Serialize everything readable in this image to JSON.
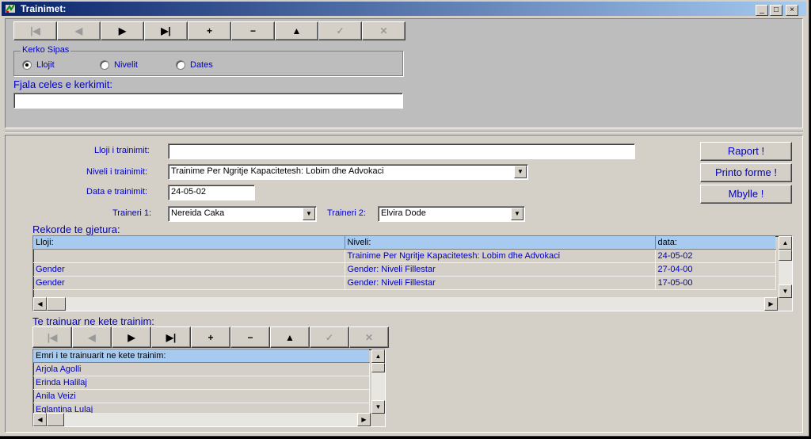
{
  "window": {
    "title": "Trainimet:",
    "controls": [
      "_",
      "□",
      "×"
    ]
  },
  "navigator": {
    "buttons": [
      {
        "glyph": "|◀",
        "name": "first",
        "enabled": false
      },
      {
        "glyph": "◀",
        "name": "prior",
        "enabled": false
      },
      {
        "glyph": "▶",
        "name": "next",
        "enabled": true
      },
      {
        "glyph": "▶|",
        "name": "last",
        "enabled": true
      },
      {
        "glyph": "+",
        "name": "insert",
        "enabled": true
      },
      {
        "glyph": "−",
        "name": "delete",
        "enabled": true
      },
      {
        "glyph": "▲",
        "name": "edit",
        "enabled": true
      },
      {
        "glyph": "✓",
        "name": "post",
        "enabled": false
      },
      {
        "glyph": "✕",
        "name": "cancel",
        "enabled": false
      }
    ]
  },
  "search": {
    "group_title": "Kerko Sipas",
    "options": [
      {
        "label": "Llojit",
        "selected": true
      },
      {
        "label": "Nivelit",
        "selected": false
      },
      {
        "label": "Dates",
        "selected": false
      }
    ],
    "keyword_label": "Fjala celes e kerkimit:",
    "keyword_value": ""
  },
  "form": {
    "type_label": "Lloji i trainimit:",
    "type_value": "",
    "level_label": "Niveli i trainimit:",
    "level_value": "Trainime Per Ngritje Kapacitetesh: Lobim dhe Advokaci",
    "date_label": "Data e trainimit:",
    "date_value": "24-05-02",
    "trainer1_label": "Traineri 1:",
    "trainer1_value": "Nereida Caka",
    "trainer2_label": "Traineri 2:",
    "trainer2_value": "Elvira Dode"
  },
  "actions": {
    "report": "Raport !",
    "print": "Printo forme !",
    "close": "Mbylle !"
  },
  "records": {
    "title": "Rekorde te gjetura:",
    "columns": [
      "Lloji:",
      "Niveli:",
      "data:"
    ],
    "rows": [
      [
        "",
        "Trainime Per Ngritje Kapacitetesh: Lobim dhe Advokaci",
        "24-05-02"
      ],
      [
        "Gender",
        "Gender: Niveli Fillestar",
        "27-04-00"
      ],
      [
        "Gender",
        "Gender: Niveli Fillestar",
        "17-05-00"
      ]
    ]
  },
  "trainees": {
    "title": "Te trainuar ne kete trainim:",
    "column": "Emri i te trainuarit ne kete trainim:",
    "rows": [
      "Arjola Agolli",
      "Erinda Halilaj",
      "Anila Veizi",
      "Eglantina Lulaj"
    ]
  },
  "colors": {
    "title_bar_start": "#0a246a",
    "title_bar_end": "#a6caf0",
    "label_text": "#0000c0",
    "header_bg": "#a6caf0"
  }
}
